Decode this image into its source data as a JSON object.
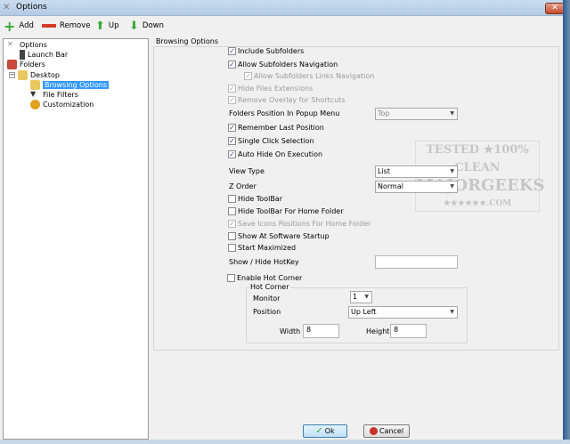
{
  "window": {
    "title": "Options",
    "close": "✕"
  },
  "toolbar": {
    "add": "Add",
    "remove": "Remove",
    "up": "Up",
    "down": "Down"
  },
  "tree": {
    "options": "Options",
    "launch_bar": "Launch Bar",
    "folders": "Folders",
    "desktop": "Desktop",
    "browsing_options": "Browsing Options",
    "file_filters": "File Filters",
    "customization": "Customization",
    "expander": "−"
  },
  "panel": {
    "group_title": "Browsing Options",
    "include_subfolders": {
      "label": "Include Subfolders",
      "checked": true
    },
    "allow_subfolders_nav": {
      "label": "Allow Subfolders Navigation",
      "checked": true
    },
    "allow_links_nav": {
      "label": "Allow Subfolders Links Navigation",
      "checked": true
    },
    "hide_ext": {
      "label": "Hide Files Extensions",
      "checked": true
    },
    "remove_overlay": {
      "label": "Remove Overlay for Shortcuts",
      "checked": true
    },
    "folders_position_label": "Folders Position In Popup Menu",
    "folders_position_value": "Top",
    "remember_last": {
      "label": "Remember Last Position",
      "checked": true
    },
    "single_click": {
      "label": "Single Click Selection",
      "checked": true
    },
    "auto_hide": {
      "label": "Auto Hide On Execution",
      "checked": true
    },
    "view_type_label": "View Type",
    "view_type_value": "List",
    "z_order_label": "Z Order",
    "z_order_value": "Normal",
    "hide_toolbar": {
      "label": "Hide ToolBar",
      "checked": false
    },
    "hide_toolbar_home": {
      "label": "Hide ToolBar For Home Folder",
      "checked": false
    },
    "save_icons": {
      "label": "Save Icons Positions For Home Folder",
      "checked": true
    },
    "show_startup": {
      "label": "Show At Software Startup",
      "checked": false
    },
    "start_max": {
      "label": "Start Maximized",
      "checked": false
    },
    "hotkey_label": "Show / Hide HotKey",
    "hotkey_value": "",
    "enable_hot_corner": {
      "label": "Enable Hot Corner",
      "checked": false
    },
    "hot_corner": {
      "title": "Hot Corner",
      "monitor_label": "Monitor",
      "monitor_value": "1",
      "position_label": "Position",
      "position_value": "Up Left",
      "width_label": "Width",
      "width_value": "8",
      "height_label": "Height",
      "height_value": "8"
    }
  },
  "buttons": {
    "ok": "Ok",
    "cancel": "Cancel"
  },
  "watermark": {
    "line1": "TESTED ★100% CLEAN",
    "line2": "MAJORGEEKS",
    "line3": "★★★★★★.COM"
  },
  "check_mark": "✓"
}
